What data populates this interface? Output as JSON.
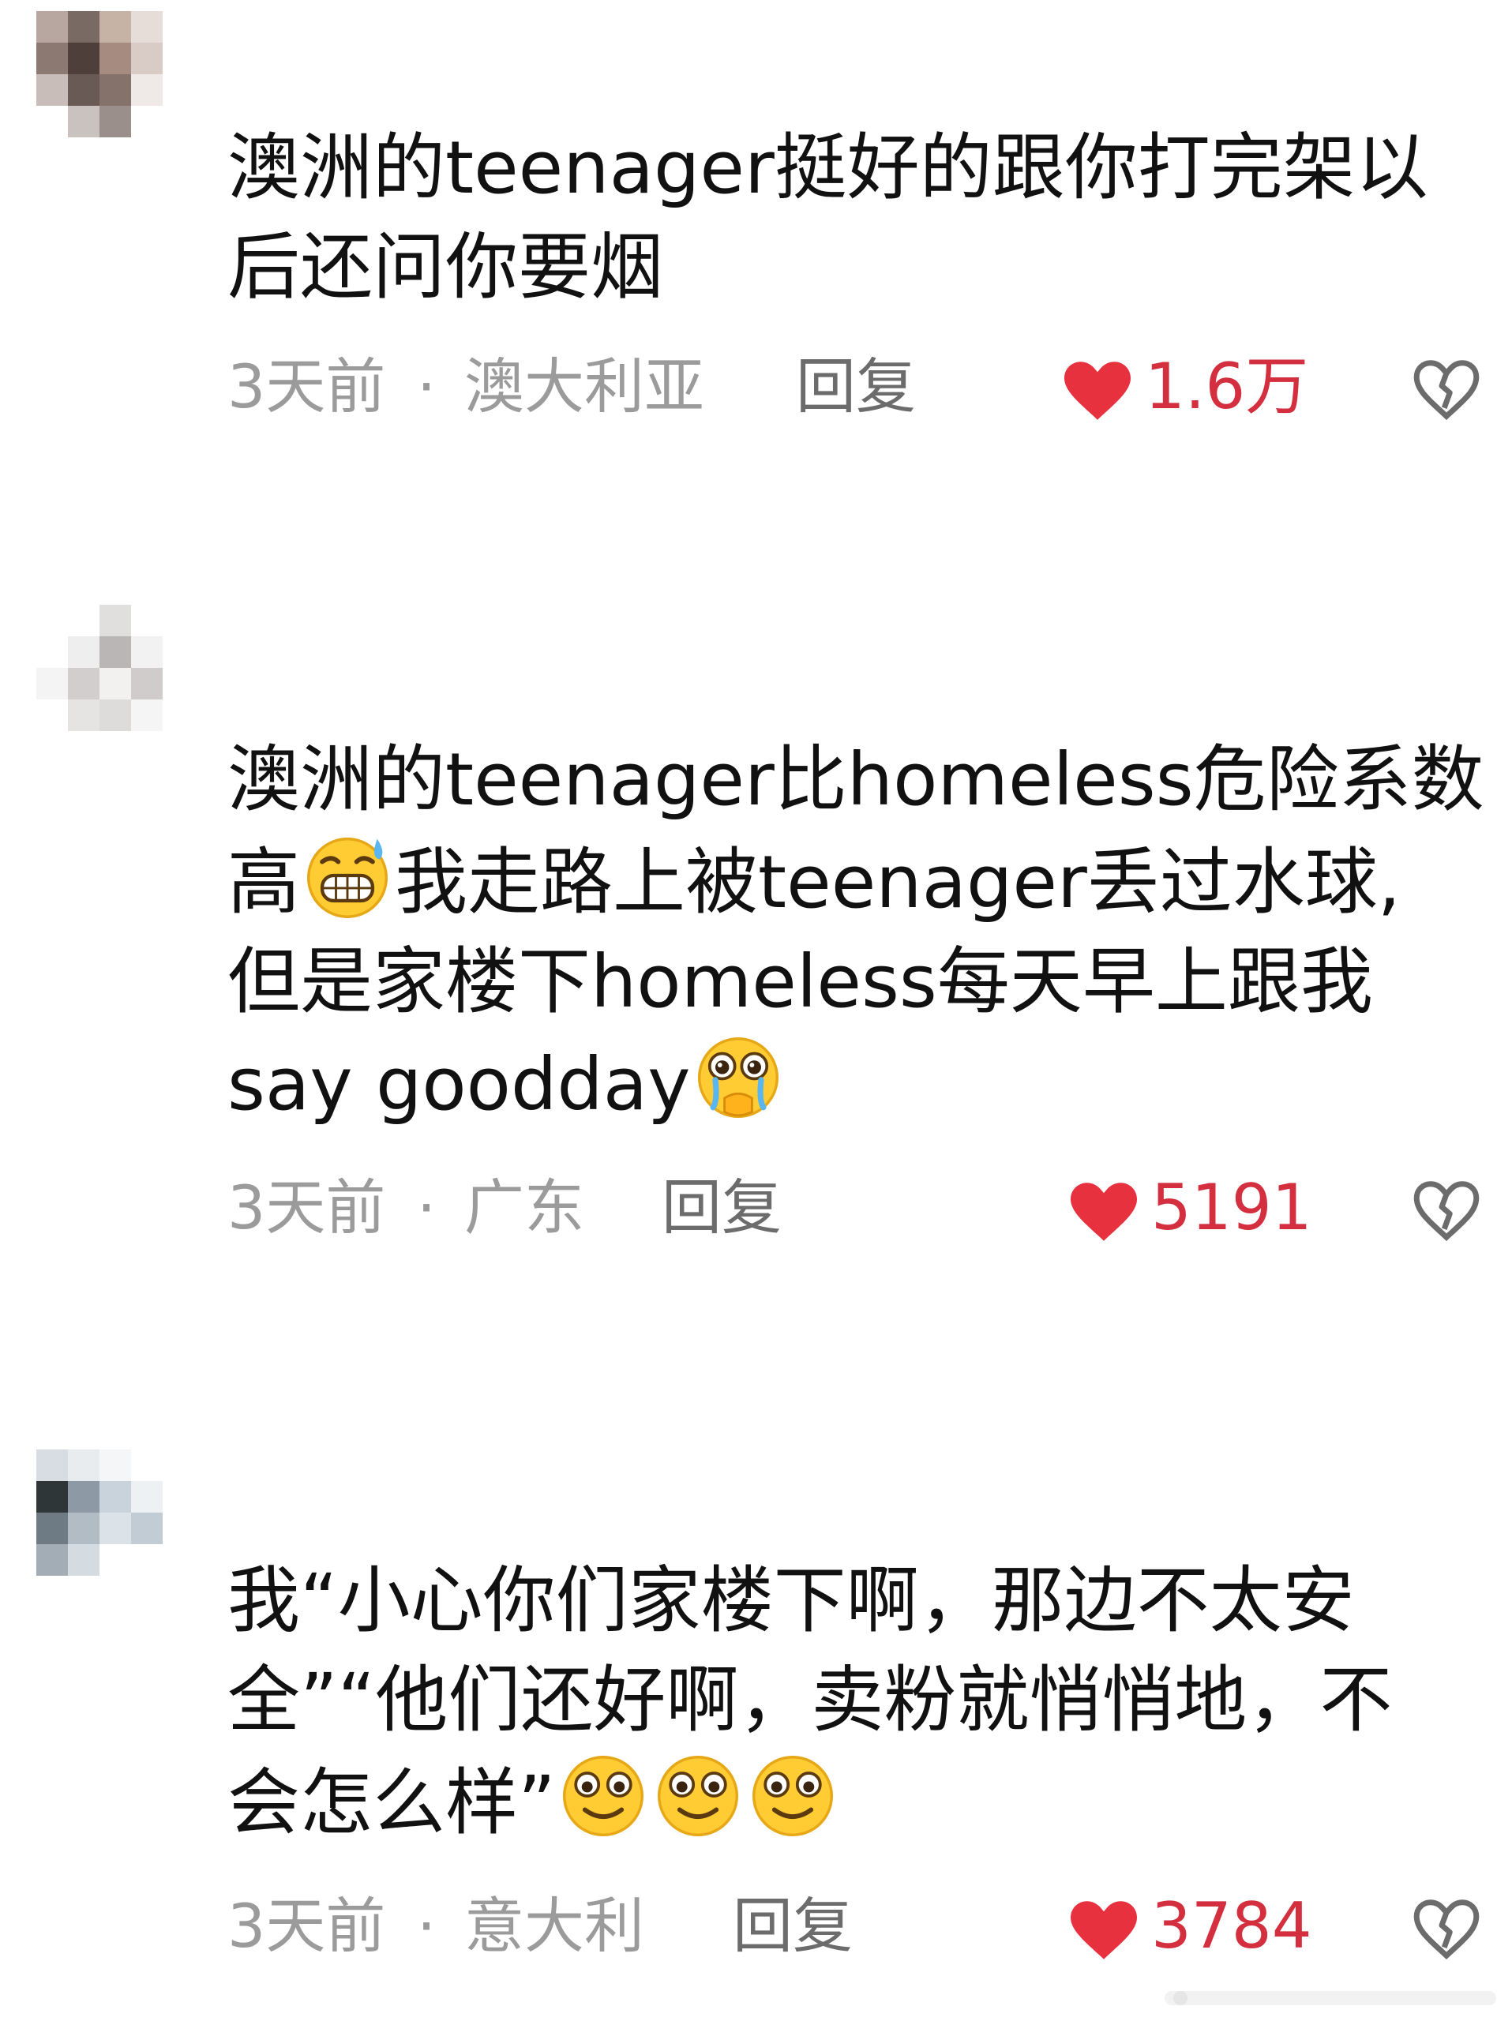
{
  "comments": [
    {
      "lines": [
        "澳洲的teenager挺好的跟你打完架以",
        "后还问你要烟"
      ],
      "time": "3天前",
      "location": "澳大利亚",
      "reply": "回复",
      "likes": "1.6万"
    },
    {
      "lines": [
        "澳洲的teenager比homeless危险系数",
        "我走路上被teenager丢过水球,",
        "但是家楼下homeless每天早上跟我",
        "say goodday"
      ],
      "line2_prefix": "高",
      "time": "3天前",
      "location": "广东",
      "reply": "回复",
      "likes": "5191"
    },
    {
      "lines": [
        "我“小心你们家楼下啊，那边不太安",
        "全”“他们还好啊，卖粉就悄悄地，不",
        "会怎么样”"
      ],
      "time": "3天前",
      "location": "意大利",
      "reply": "回复",
      "likes": "3784"
    }
  ],
  "separator": "·",
  "colors": {
    "text": "#111111",
    "meta": "#9b9b9b",
    "reply": "#6c6c6c",
    "like_red": "#e8313f",
    "likes_text": "#d32f3f"
  },
  "icons": [
    "avatar",
    "grinning-sweat-emoji",
    "pleading-face-emoji",
    "smiling-face-emoji",
    "heart-icon",
    "dislike-heart-icon"
  ]
}
